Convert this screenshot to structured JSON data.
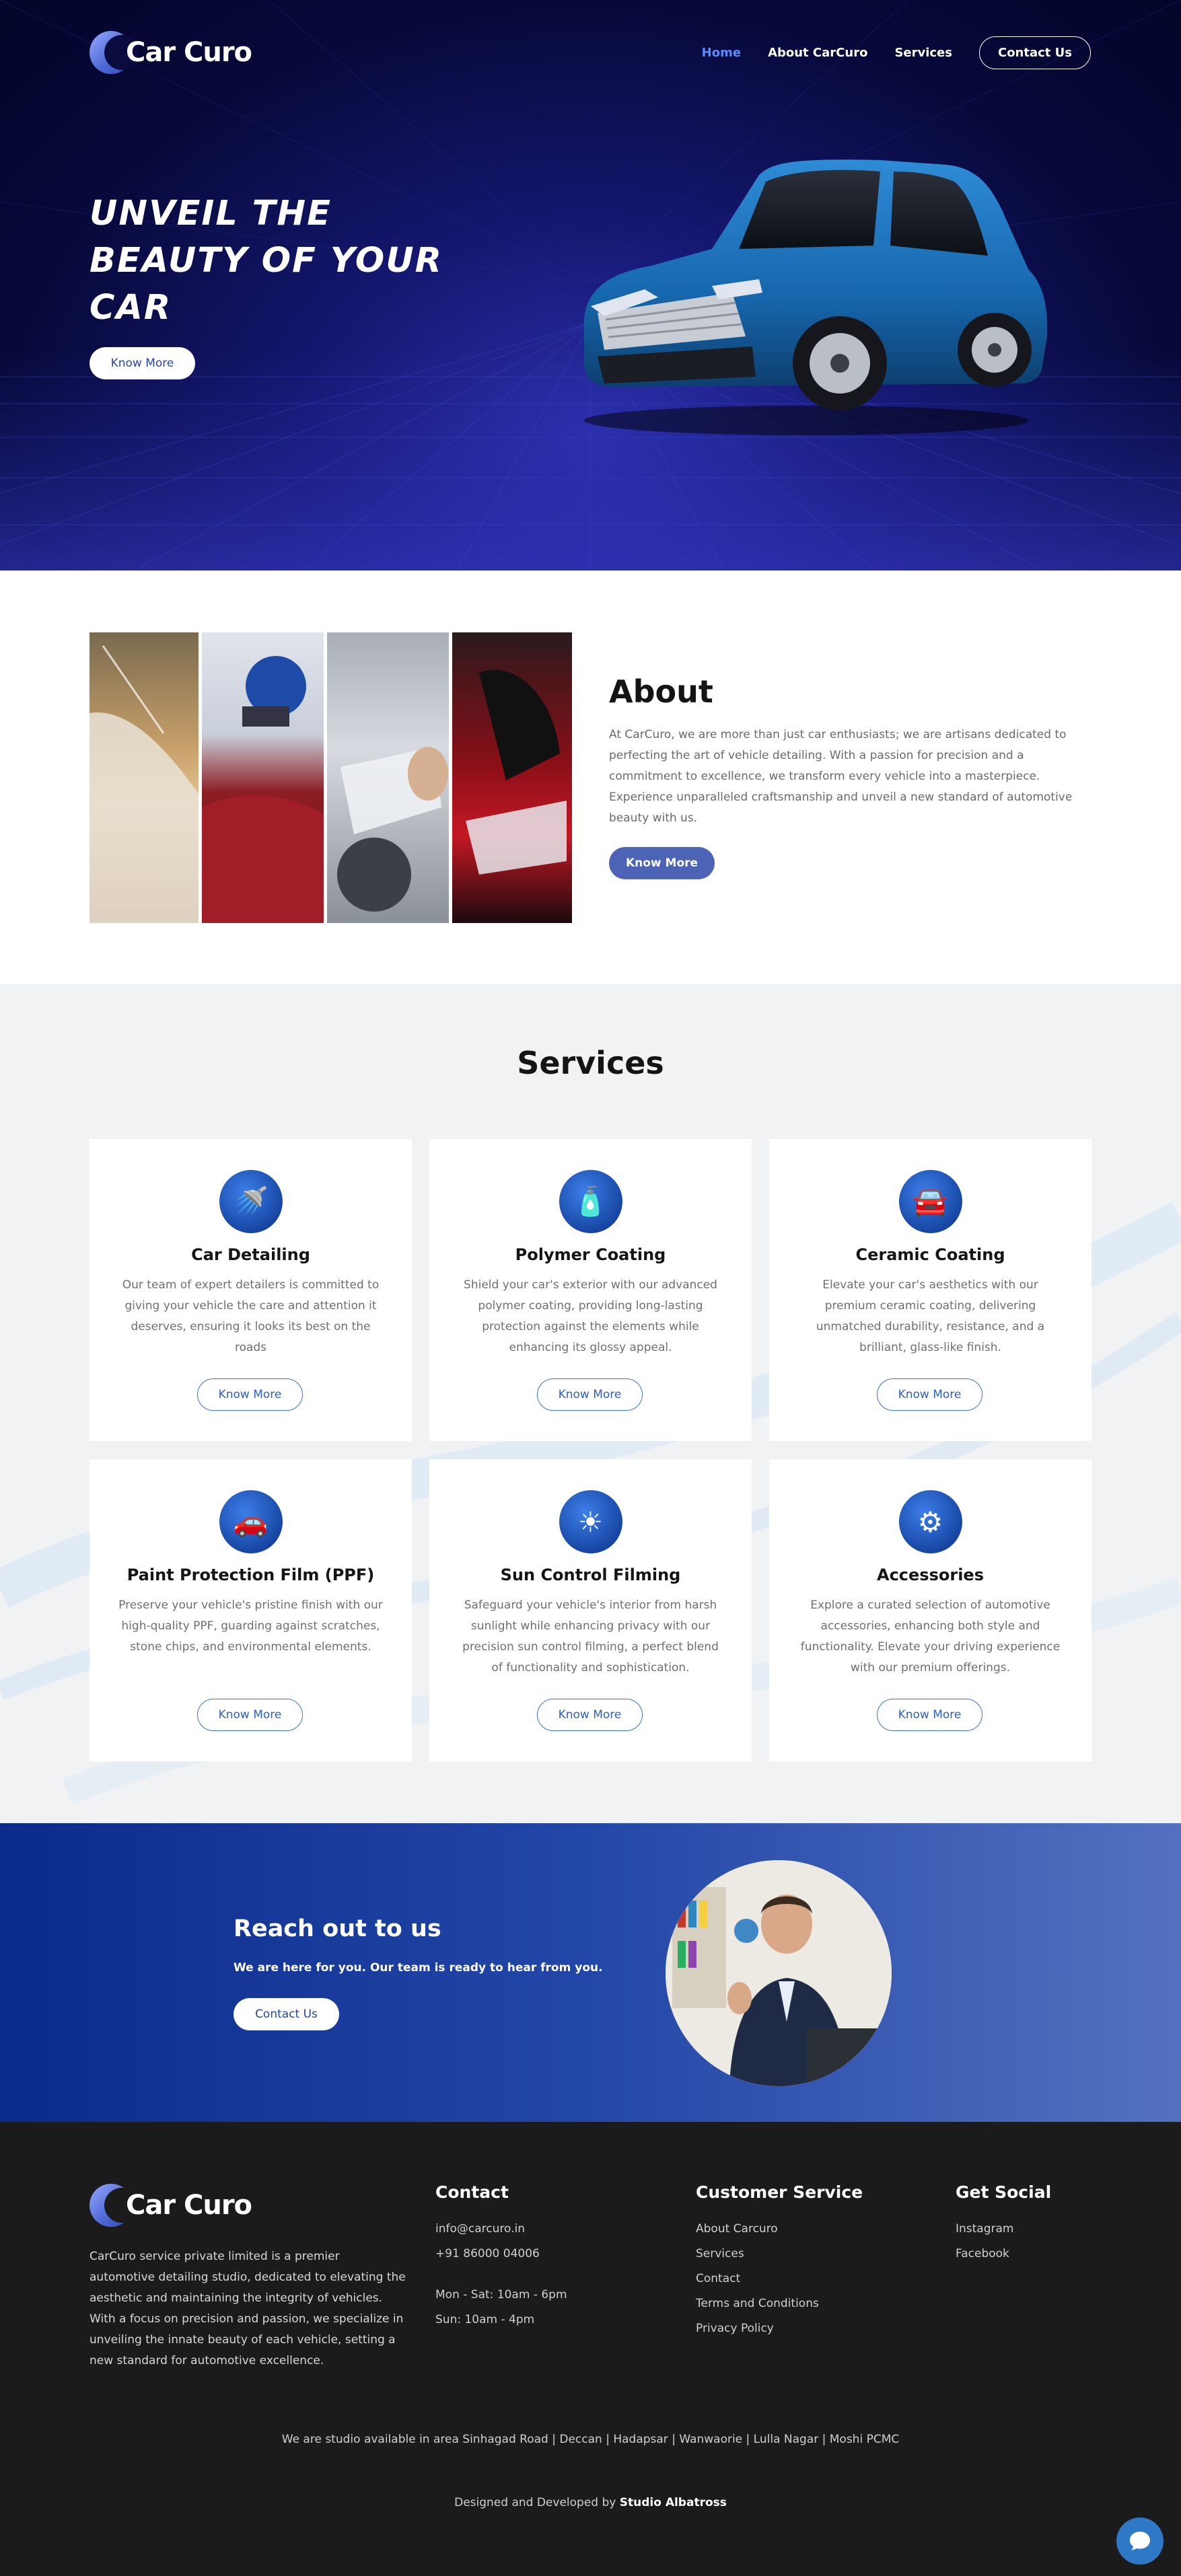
{
  "brand": {
    "name": "Car Curo"
  },
  "nav": {
    "items": [
      {
        "label": "Home",
        "active": true
      },
      {
        "label": "About CarCuro",
        "active": false
      },
      {
        "label": "Services",
        "active": false
      }
    ],
    "contact_label": "Contact Us"
  },
  "hero": {
    "title_lines": [
      "UNVEIL THE",
      "BEAUTY OF YOUR",
      "CAR"
    ],
    "button_label": "Know More"
  },
  "about": {
    "title": "About",
    "body": "At CarCuro, we are more than just car enthusiasts; we are artisans dedicated to perfecting the art of vehicle detailing. With a passion for precision and a commitment to excellence, we transform every vehicle into a masterpiece. Experience unparalleled craftsmanship and unveil a new standard of automotive beauty with us.",
    "button_label": "Know More"
  },
  "services": {
    "title": "Services",
    "button_label": "Know More",
    "cards": [
      {
        "icon": "car-wash-icon",
        "title": "Car Detailing",
        "text": "Our team of expert detailers is committed to giving your vehicle the care and attention it deserves, ensuring it looks its best on the roads"
      },
      {
        "icon": "polymer-bottle-icon",
        "title": "Polymer Coating",
        "text": "Shield your car's exterior with our advanced polymer coating, providing long-lasting protection against the elements while enhancing its glossy appeal."
      },
      {
        "icon": "car-shield-icon",
        "title": "Ceramic Coating",
        "text": "Elevate your car's aesthetics with our premium ceramic coating, delivering unmatched durability, resistance, and a brilliant, glass-like finish."
      },
      {
        "icon": "car-front-icon",
        "title": "Paint Protection Film (PPF)",
        "text": "Preserve your vehicle's pristine finish with our high-quality PPF, guarding against scratches, stone chips, and environmental elements."
      },
      {
        "icon": "sun-film-icon",
        "title": "Sun Control Filming",
        "text": "Safeguard your vehicle's interior from harsh sunlight while enhancing privacy with our precision sun control filming, a perfect blend of functionality and sophistication."
      },
      {
        "icon": "car-accessories-icon",
        "title": "Accessories",
        "text": "Explore a curated selection of automotive accessories, enhancing both style and functionality. Elevate your driving experience with our premium offerings."
      }
    ]
  },
  "reach": {
    "title": "Reach out to us",
    "subtitle": "We are here for you. Our team is ready to hear from you.",
    "button_label": "Contact Us"
  },
  "footer": {
    "about_text": "CarCuro service private limited is a premier automotive detailing studio, dedicated to elevating the aesthetic and maintaining the integrity of vehicles. With a focus on precision and passion, we specialize in unveiling the innate beauty of each vehicle, setting a new standard for automotive excellence.",
    "contact": {
      "title": "Contact",
      "email": "info@carcuro.in",
      "phone": "+91 86000 04006",
      "hours_weekday": "Mon - Sat: 10am - 6pm",
      "hours_sunday": "Sun: 10am - 4pm"
    },
    "customer_service": {
      "title": "Customer Service",
      "links": [
        "About Carcuro",
        "Services",
        "Contact",
        "Terms and Conditions",
        "Privacy Policy"
      ]
    },
    "social": {
      "title": "Get Social",
      "links": [
        "Instagram",
        "Facebook"
      ]
    },
    "areas": "We are studio available in area Sinhagad Road | Deccan | Hadapsar | Wanwaorie | Lulla Nagar | Moshi PCMC",
    "credit_prefix": "Designed and Developed by",
    "credit_name": "Studio Albatross"
  },
  "colors": {
    "accent": "#4d63b5",
    "nav_active": "#5b8cff",
    "hero_bg": "#07093a",
    "footer_bg": "#1b1b1b",
    "reach_bg": "#2347a8"
  }
}
